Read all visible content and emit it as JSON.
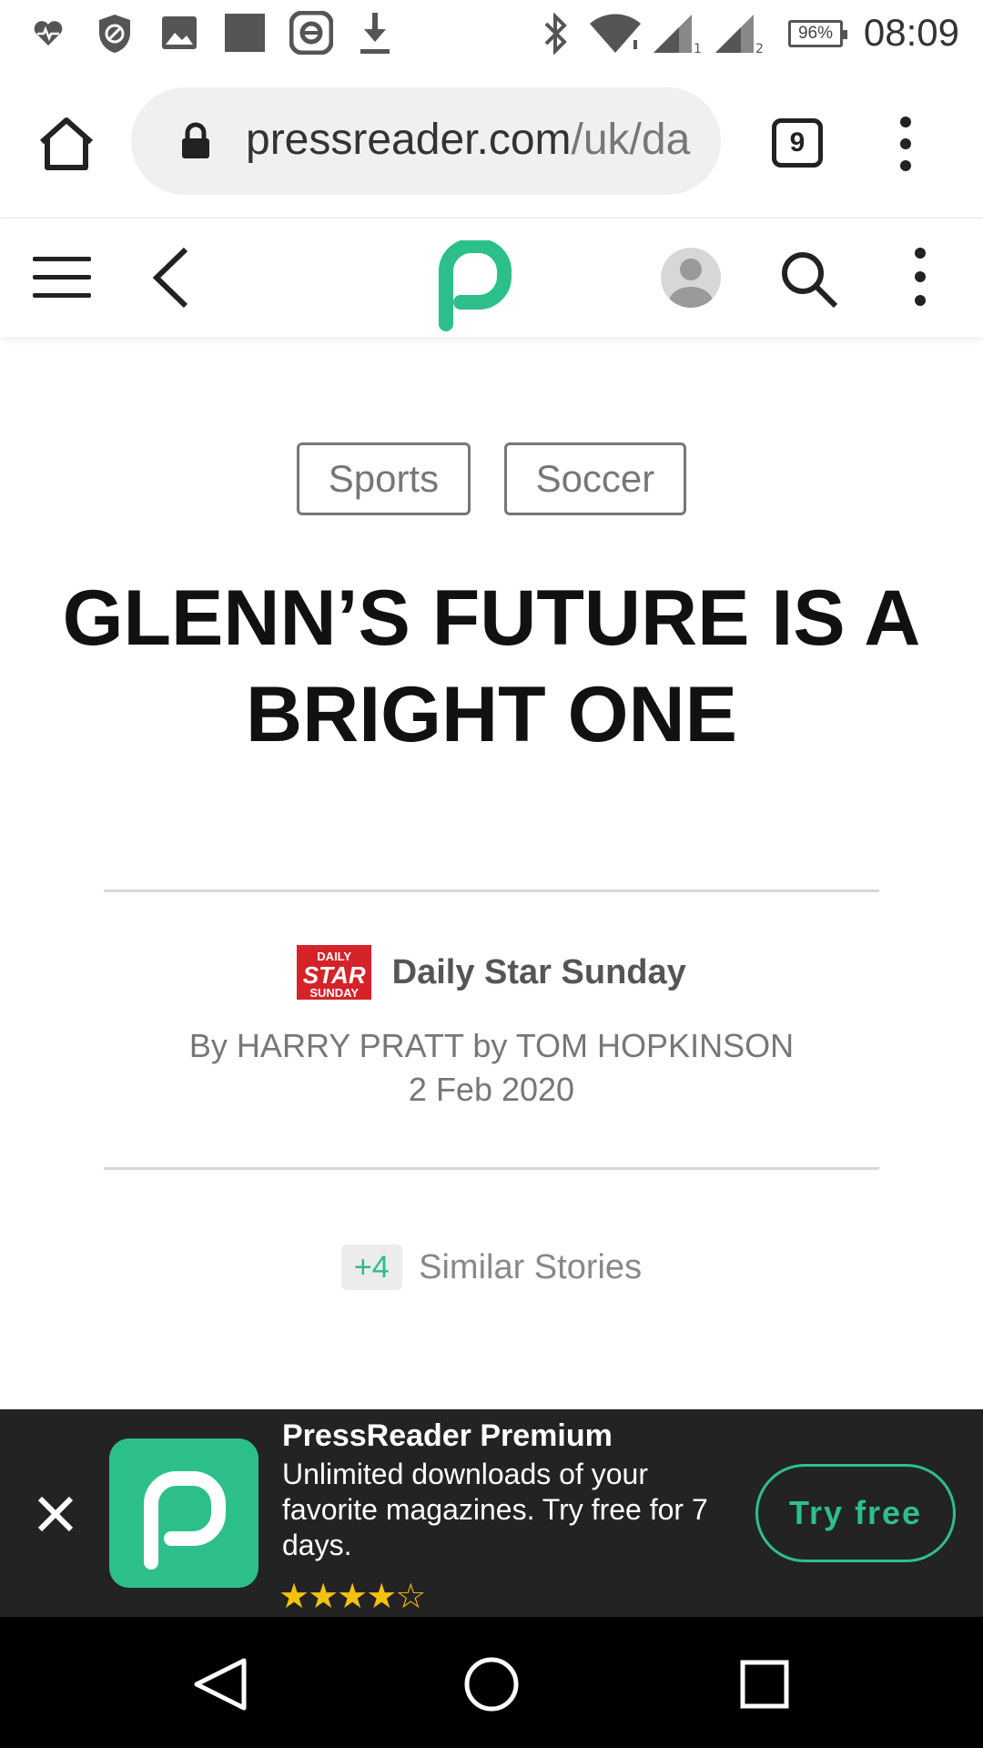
{
  "status_bar": {
    "battery": "96%",
    "time": "08:09",
    "left_icons": [
      "heart-monitor-icon",
      "blocked-icon",
      "image-icon",
      "square-icon",
      "e-icon",
      "download-icon"
    ],
    "right_icons": [
      "bluetooth-icon",
      "wifi-icon",
      "signal-1-icon",
      "signal-2-icon"
    ]
  },
  "browser": {
    "url_main": "pressreader.com",
    "url_path": "/uk/da",
    "tab_count": "9"
  },
  "tags": [
    {
      "label": "Sports"
    },
    {
      "label": "Soccer"
    }
  ],
  "article": {
    "headline": "GLENN’S FUTURE IS A BRIGHT ONE",
    "source_logo_top": "DAILY",
    "source_logo_mid": "STAR",
    "source_logo_bottom": "SUNDAY",
    "source_name": "Daily Star Sunday",
    "byline": "By HARRY PRATT by TOM HOPKINSON",
    "date": "2 Feb 2020",
    "similar_count": "+4",
    "similar_label": "Similar Stories"
  },
  "promo": {
    "title": "PressReader Premium",
    "description": "Unlimited downloads of your favorite magazines. Try free for 7 days.",
    "rating": 4.5,
    "stars_text": "★★★★☆",
    "button": "Try free"
  },
  "colors": {
    "brand_green": "#2dbf8a",
    "source_red": "#d62229",
    "promo_bg": "#232323"
  }
}
